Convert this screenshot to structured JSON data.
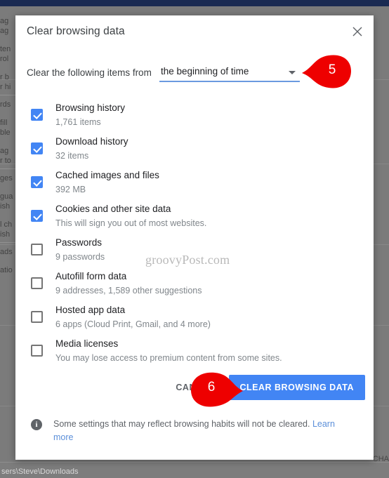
{
  "background": {
    "left_fragments": [
      "ag",
      "ag",
      "",
      "ten",
      "rol",
      "",
      "r b",
      "r hi",
      "RULE",
      "rds",
      "",
      "fill",
      "ble",
      "",
      "ag",
      "r to",
      "RULE",
      "ges",
      "",
      "gua",
      "ish",
      "",
      "l ch",
      "ish",
      "RULE",
      "ads",
      "",
      "atio"
    ],
    "right_fragment": "CHA",
    "download_path": "sers\\Steve\\Downloads"
  },
  "dialog": {
    "title": "Clear browsing data",
    "close_icon": "close-icon",
    "range": {
      "label": "Clear the following items from",
      "selected": "the beginning of time",
      "caret_icon": "chevron-down-icon"
    },
    "items": [
      {
        "title": "Browsing history",
        "sub": "1,761 items",
        "checked": true
      },
      {
        "title": "Download history",
        "sub": "32 items",
        "checked": true
      },
      {
        "title": "Cached images and files",
        "sub": "392 MB",
        "checked": true
      },
      {
        "title": "Cookies and other site data",
        "sub": "This will sign you out of most websites.",
        "checked": true
      },
      {
        "title": "Passwords",
        "sub": "9 passwords",
        "checked": false
      },
      {
        "title": "Autofill form data",
        "sub": "9 addresses, 1,589 other suggestions",
        "checked": false
      },
      {
        "title": "Hosted app data",
        "sub": "6 apps (Cloud Print, Gmail, and 4 more)",
        "checked": false
      },
      {
        "title": "Media licenses",
        "sub": "You may lose access to premium content from some sites.",
        "checked": false
      }
    ],
    "buttons": {
      "cancel": "CANCEL",
      "clear": "CLEAR BROWSING DATA"
    },
    "footer": {
      "info_icon": "info-icon",
      "text": "Some settings that may reflect browsing habits will not be cleared. ",
      "link": "Learn more"
    }
  },
  "watermark": "groovyPost.com",
  "callouts": [
    {
      "number": "5",
      "direction": "left"
    },
    {
      "number": "6",
      "direction": "right"
    }
  ],
  "colors": {
    "accent_blue": "#4285f4",
    "callout_red": "#ee0000",
    "link_blue": "#5b8fd9",
    "title_bar": "#1a2a52"
  }
}
